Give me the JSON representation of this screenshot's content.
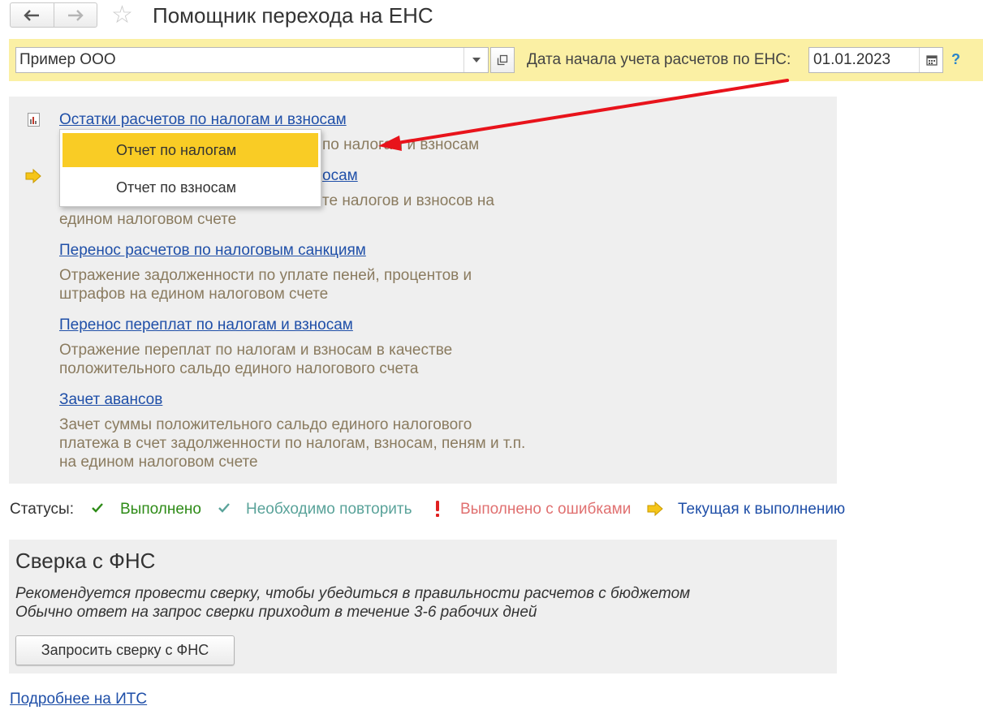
{
  "window": {
    "title": "Помощник перехода на ЕНС"
  },
  "header": {
    "organization_value": "Пример ООО",
    "date_label": "Дата начала учета расчетов по ЕНС:",
    "date_value": "01.01.2023",
    "help_label": "?"
  },
  "steps": [
    {
      "link": "Остатки расчетов по налогам и взносам",
      "description_lines": [
        "",
        "по налогам и взносам"
      ],
      "status": "report-icon"
    },
    {
      "link": "осам",
      "description_lines": [
        "",
        "те налогов и взносов на",
        "едином налоговом счете"
      ],
      "status": "current"
    },
    {
      "link": "Перенос расчетов по налоговым санкциям",
      "description_lines": [
        "Отражение задолженности по уплате пеней, процентов и",
        "штрафов на едином налоговом счете"
      ]
    },
    {
      "link": "Перенос переплат по налогам и взносам",
      "description_lines": [
        "Отражение переплат по налогам и взносам в качестве",
        "положительного сальдо единого налогового счета"
      ]
    },
    {
      "link": "Зачет авансов",
      "description_lines": [
        "Зачет суммы положительного сальдо единого налогового",
        "платежа в счет задолженности по налогам, взносам, пеням и т.п.",
        "на едином налоговом счете"
      ]
    }
  ],
  "popup_menu": {
    "items": [
      "Отчет по налогам",
      "Отчет по взносам"
    ],
    "selected_index": 0
  },
  "statuses": {
    "label": "Статусы:",
    "items": [
      {
        "text": "Выполнено",
        "color": "#2e8b17"
      },
      {
        "text": "Необходимо повторить",
        "color": "#5aa39a"
      },
      {
        "text": "Выполнено с ошибками",
        "color": "#e07070"
      },
      {
        "text": "Текущая к выполнению",
        "color": "#1f4fa8"
      }
    ]
  },
  "reconciliation": {
    "title": "Сверка с ФНС",
    "text_lines": [
      "Рекомендуется провести сверку, чтобы убедиться в правильности расчетов с бюджетом",
      "Обычно ответ на запрос сверки приходит в течение 3-6 рабочих дней"
    ],
    "button_label": "Запросить сверку с ФНС"
  },
  "footer": {
    "more_link": "Подробнее на ИТС"
  },
  "colors": {
    "accent_yellow": "#f9cc25",
    "bar_yellow": "#fbf0a4",
    "link_blue": "#1f4fa8",
    "annotation_red": "#e8131b"
  }
}
